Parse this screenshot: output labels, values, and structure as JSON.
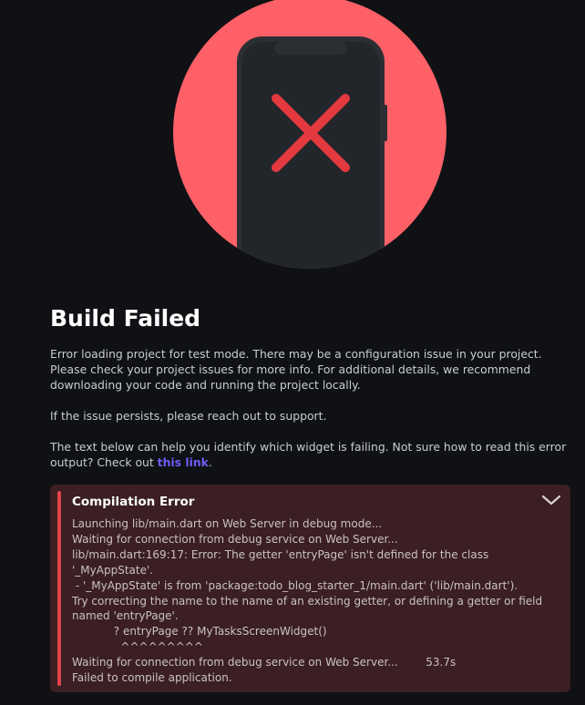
{
  "title": "Build Failed",
  "paragraphs": {
    "p1": "Error loading project for test mode. There may be a configuration issue in your project. Please check your project issues for more info. For additional details, we recommend downloading your code and running the project locally.",
    "p2": "If the issue persists, please reach out to support.",
    "p3_prefix": "The text below can help you identify which widget is failing. Not sure how to read this error output? Check out ",
    "p3_link": "this link",
    "p3_suffix": "."
  },
  "error_panel": {
    "heading": "Compilation Error",
    "lines": [
      "Launching lib/main.dart on Web Server in debug mode...",
      "Waiting for connection from debug service on Web Server...",
      "lib/main.dart:169:17: Error: The getter 'entryPage' isn't defined for the class",
      "'_MyAppState'.",
      " - '_MyAppState' is from 'package:todo_blog_starter_1/main.dart' ('lib/main.dart').",
      "Try correcting the name to the name of an existing getter, or defining a getter or field",
      "named 'entryPage'.",
      "            ? entryPage ?? MyTasksScreenWidget()",
      "              ^^^^^^^^^",
      "Waiting for connection from debug service on Web Server...        53.7s",
      "Failed to compile application."
    ]
  },
  "icons": {
    "illustration": "phone-with-error-x-icon",
    "toggle": "chevron-down-icon"
  },
  "colors": {
    "background": "#0f1114",
    "illustration_circle": "#fd6167",
    "phone_body": "#25292e",
    "error_x": "#e3393f",
    "panel_background": "#3b1f23",
    "panel_accent": "#e2424a",
    "link": "#6d5cf5"
  }
}
